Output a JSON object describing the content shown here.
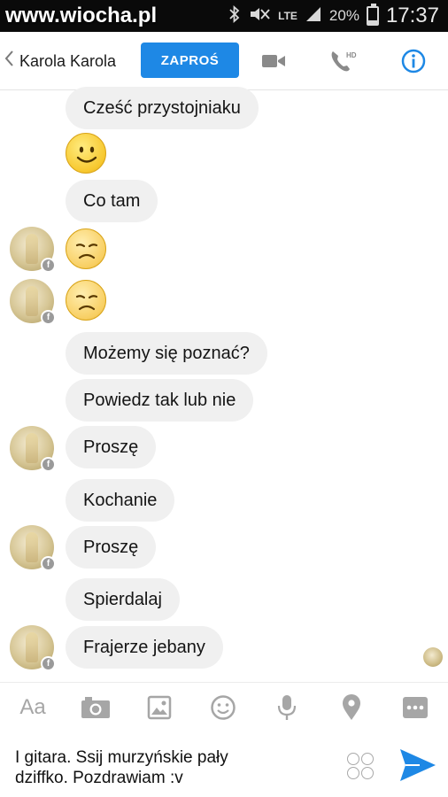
{
  "status_bar": {
    "watermark": "www.wiocha.pl",
    "network": "LTE",
    "battery_percent": "20%",
    "battery_level": 0.2,
    "time": "17:37"
  },
  "header": {
    "back_icon": "chevron-left-icon",
    "contact_name": "Karola Karola",
    "invite_label": "ZAPROŚ",
    "call_hd_label": "HD",
    "accent_color": "#1e88e5"
  },
  "messages": [
    {
      "kind": "text",
      "text": "Cześć przystojniaku",
      "avatar": false
    },
    {
      "kind": "emoji",
      "emoji": "smiling-face",
      "avatar": false
    },
    {
      "kind": "text",
      "text": "Co tam",
      "avatar": false
    },
    {
      "kind": "emoji",
      "emoji": "sad-face",
      "avatar": true
    },
    {
      "kind": "emoji",
      "emoji": "sad-face",
      "avatar": true
    },
    {
      "kind": "text",
      "text": "Możemy się poznać?",
      "avatar": false
    },
    {
      "kind": "text",
      "text": "Powiedz tak lub nie",
      "avatar": false
    },
    {
      "kind": "text",
      "text": "Proszę",
      "avatar": true
    },
    {
      "kind": "text",
      "text": "Kochanie",
      "avatar": false
    },
    {
      "kind": "text",
      "text": "Proszę",
      "avatar": true
    },
    {
      "kind": "text",
      "text": "Spierdalaj",
      "avatar": false
    },
    {
      "kind": "text",
      "text": "Frajerze jebany",
      "avatar": true
    }
  ],
  "composer": {
    "aa_label": "Aa",
    "draft_text": "I gitara. Ssij murzyńskie pały\ndziffko. Pozdrawiam :v",
    "tools": [
      "camera-icon",
      "gallery-icon",
      "emoji-icon",
      "microphone-icon",
      "location-icon",
      "more-icon"
    ],
    "send_icon": "send-icon"
  }
}
